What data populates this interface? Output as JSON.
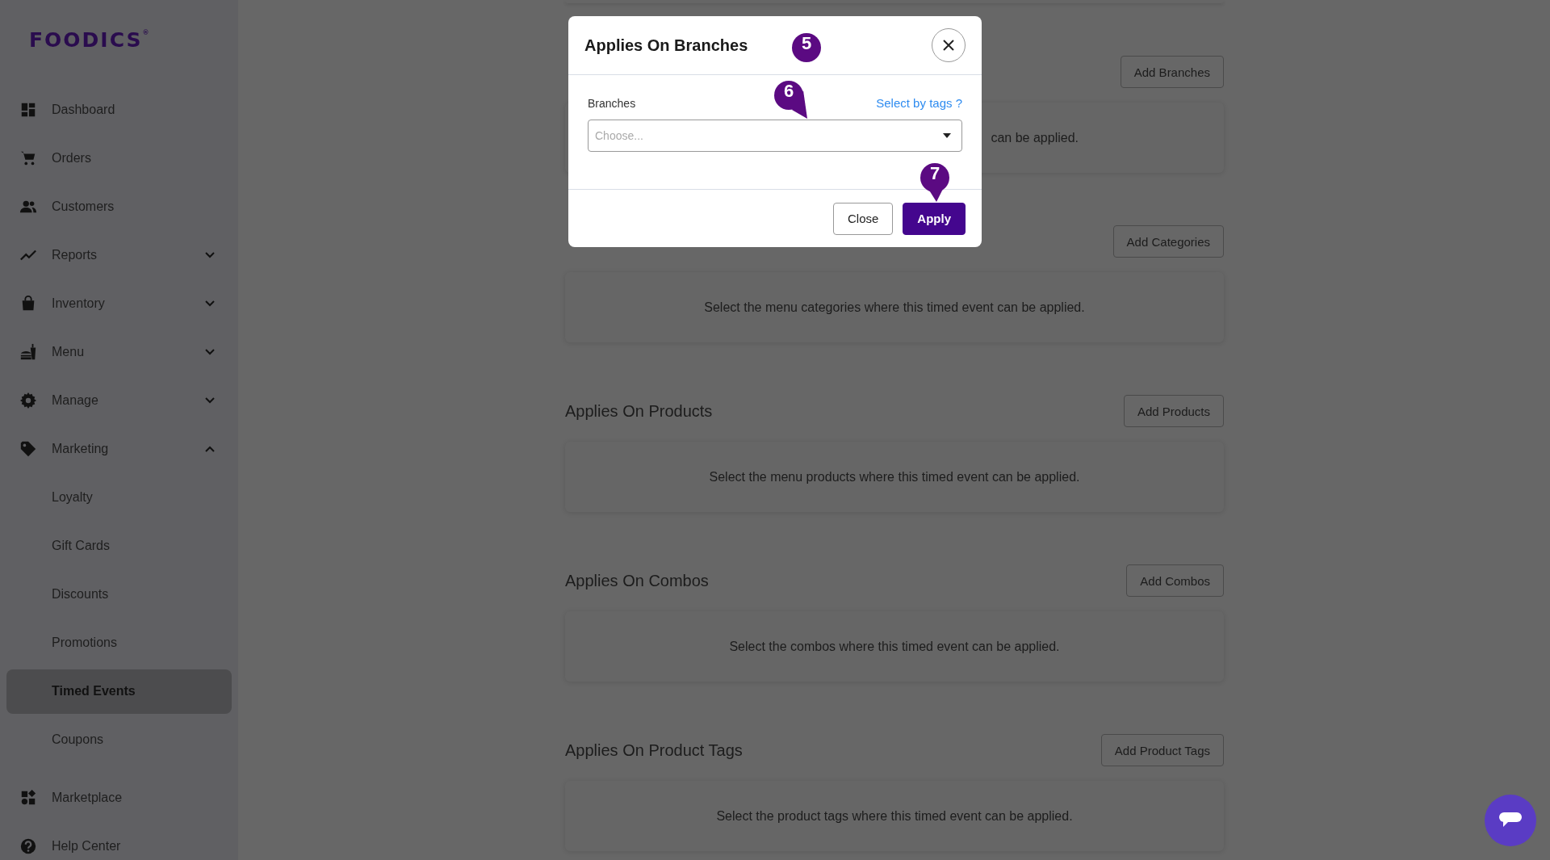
{
  "sidebar": {
    "logo": "FOODICS",
    "logo_mark": "®",
    "items": [
      {
        "label": "Dashboard",
        "kind": "link",
        "selected": false
      },
      {
        "label": "Orders",
        "kind": "link",
        "selected": false
      },
      {
        "label": "Customers",
        "kind": "link",
        "selected": false
      },
      {
        "label": "Reports",
        "kind": "group",
        "expanded": false,
        "selected": false
      },
      {
        "label": "Inventory",
        "kind": "group",
        "expanded": false,
        "selected": false
      },
      {
        "label": "Menu",
        "kind": "group",
        "expanded": false,
        "selected": false
      },
      {
        "label": "Manage",
        "kind": "group",
        "expanded": false,
        "selected": false
      },
      {
        "label": "Marketing",
        "kind": "group",
        "expanded": true,
        "selected": false,
        "children": [
          {
            "label": "Loyalty",
            "selected": false
          },
          {
            "label": "Gift Cards",
            "selected": false
          },
          {
            "label": "Discounts",
            "selected": false
          },
          {
            "label": "Promotions",
            "selected": false
          },
          {
            "label": "Timed Events",
            "selected": true
          },
          {
            "label": "Coupons",
            "selected": false
          }
        ]
      },
      {
        "label": "Marketplace",
        "kind": "link",
        "selected": false
      },
      {
        "label": "Help Center",
        "kind": "link",
        "selected": false
      }
    ]
  },
  "sections": [
    {
      "kind": "covered",
      "button": "Add Branches",
      "description": "can be applied."
    },
    {
      "kind": "covered",
      "button": "Add Categories",
      "description": "Select the menu categories where this timed event can be applied."
    },
    {
      "kind": "full",
      "title": "Applies On Products",
      "button": "Add Products",
      "description": "Select the menu products where this timed event can be applied."
    },
    {
      "kind": "full",
      "title": "Applies On Combos",
      "button": "Add Combos",
      "description": "Select the combos where this timed event can be applied."
    },
    {
      "kind": "full",
      "title": "Applies On Product Tags",
      "button": "Add Product Tags",
      "description": "Select the product tags where this timed event can be applied."
    }
  ],
  "modal": {
    "title": "Applies On Branches",
    "field": {
      "label": "Branches",
      "link": "Select by tags ?",
      "placeholder": "Choose..."
    },
    "buttons": [
      {
        "label": "Close",
        "kind": "secondary"
      },
      {
        "label": "Apply",
        "kind": "primary"
      }
    ]
  },
  "markers": [
    {
      "label": "5",
      "kind": "circle"
    },
    {
      "label": "6",
      "kind": "pin"
    },
    {
      "label": "7",
      "kind": "pin"
    }
  ]
}
